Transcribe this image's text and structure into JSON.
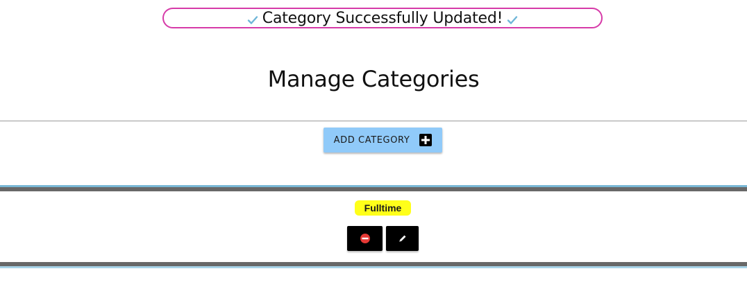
{
  "banner": {
    "message": "Category Successfully Updated!",
    "left_icon": "check-icon",
    "right_icon": "check-icon",
    "border_color": "#d63aa8",
    "icon_color": "#6fb6d8"
  },
  "page": {
    "title": "Manage Categories"
  },
  "toolbar": {
    "add_label": "ADD CATEGORY",
    "add_icon": "plus-box-icon",
    "add_button_color": "#90caf9"
  },
  "categories": [
    {
      "name": "Fulltime",
      "highlight_color": "#ffff1a",
      "actions": [
        {
          "icon": "delete-icon",
          "icon_color": "#e53935"
        },
        {
          "icon": "pencil-icon",
          "icon_color": "#ffffff"
        }
      ]
    }
  ]
}
